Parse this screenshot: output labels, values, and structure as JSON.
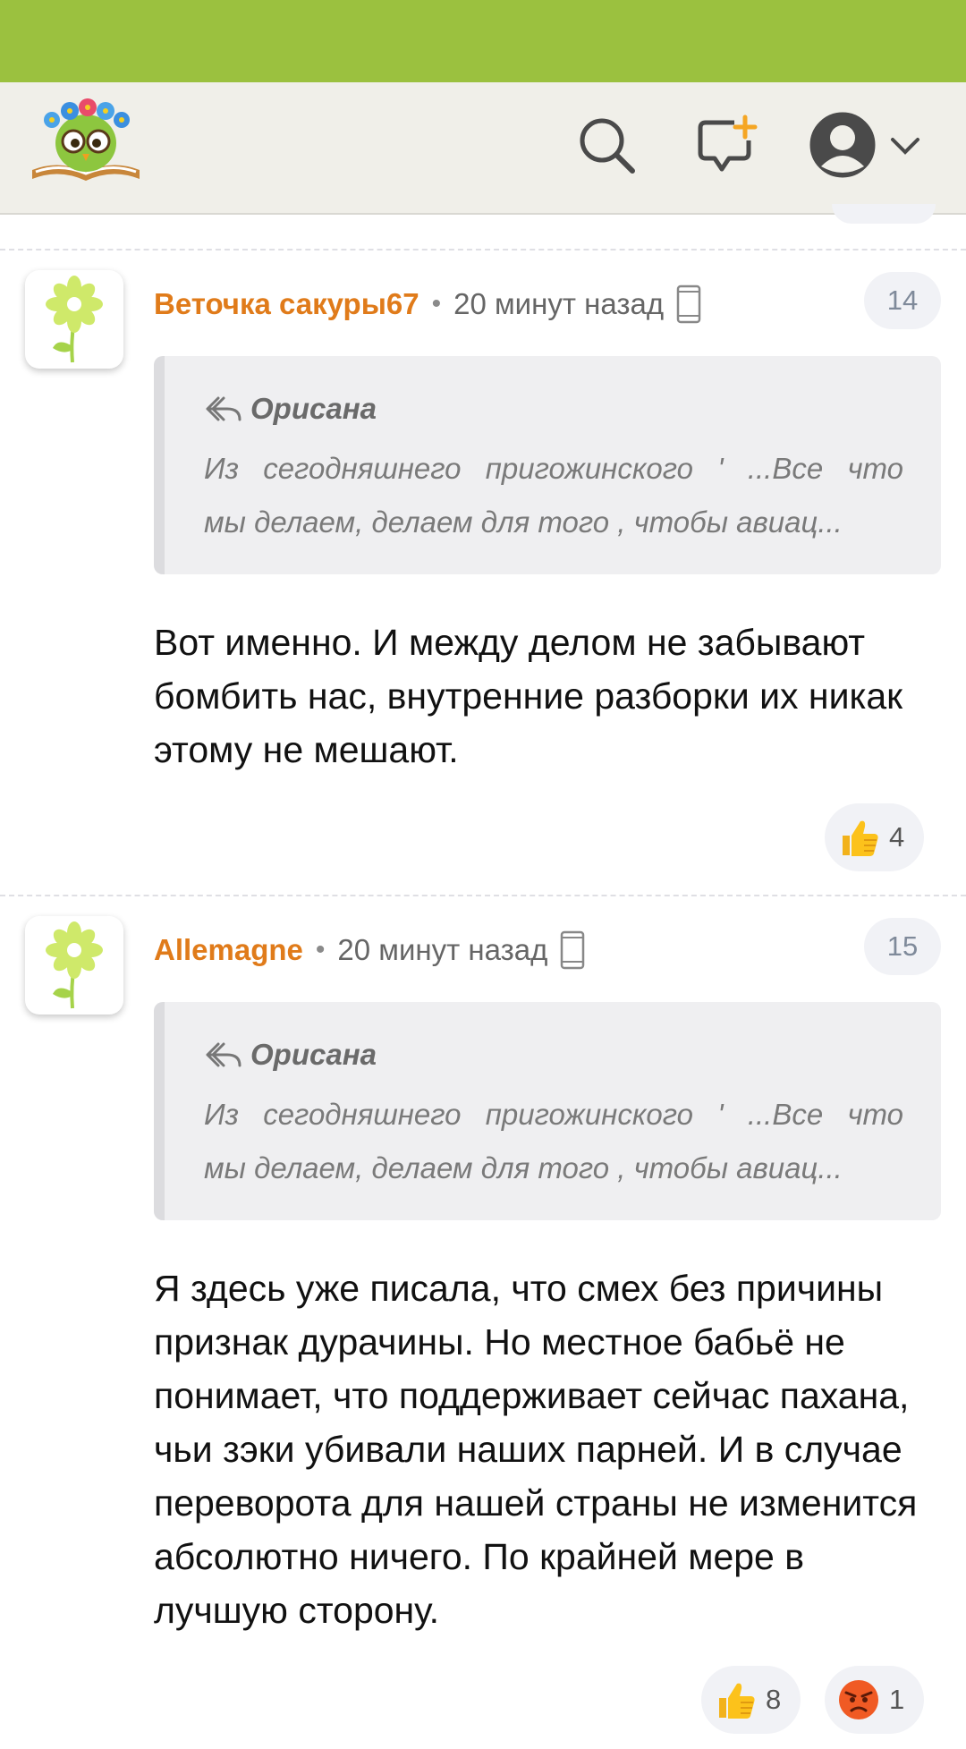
{
  "header": {
    "logo": "owl-with-flowers-on-book-logo",
    "icons": [
      "search-icon",
      "new-post-icon",
      "user-avatar-icon",
      "chevron-down-icon"
    ],
    "colors": {
      "status_bar": "#9bc13f",
      "header_bg": "#f0efe9",
      "author": "#e07b1a",
      "accent": "#f5a623"
    }
  },
  "comments": [
    {
      "author": "Веточка сакуры67",
      "separator": "•",
      "time": "20 минут назад",
      "number": "14",
      "quote": {
        "author": "Орисана",
        "line1": "Из сегодняшнего пригожинского ' ...Все что",
        "line2": "мы делаем, делаем для того , чтобы авиац..."
      },
      "text": "Вот именно. И между делом не забывают бомбить нас, внутренние разборки их никак этому не мешают.",
      "reactions": [
        {
          "icon": "thumbs-up-icon",
          "count": "4"
        }
      ]
    },
    {
      "author": "Allemagne",
      "separator": "•",
      "time": "20 минут назад",
      "number": "15",
      "quote": {
        "author": "Орисана",
        "line1": "Из сегодняшнего пригожинского ' ...Все что",
        "line2": "мы делаем, делаем для того , чтобы авиац..."
      },
      "text": "Я здесь уже писала, что смех без причины признак дурачины. Но местное бабьё не понимает, что поддерживает сейчас пахана, чьи зэки убивали наших парней. И в случае переворота для нашей страны не изменится абсолютно ничего. По крайней мере в лучшую сторону.",
      "reactions": [
        {
          "icon": "thumbs-up-icon",
          "count": "8"
        },
        {
          "icon": "angry-face-icon",
          "count": "1"
        }
      ]
    }
  ]
}
